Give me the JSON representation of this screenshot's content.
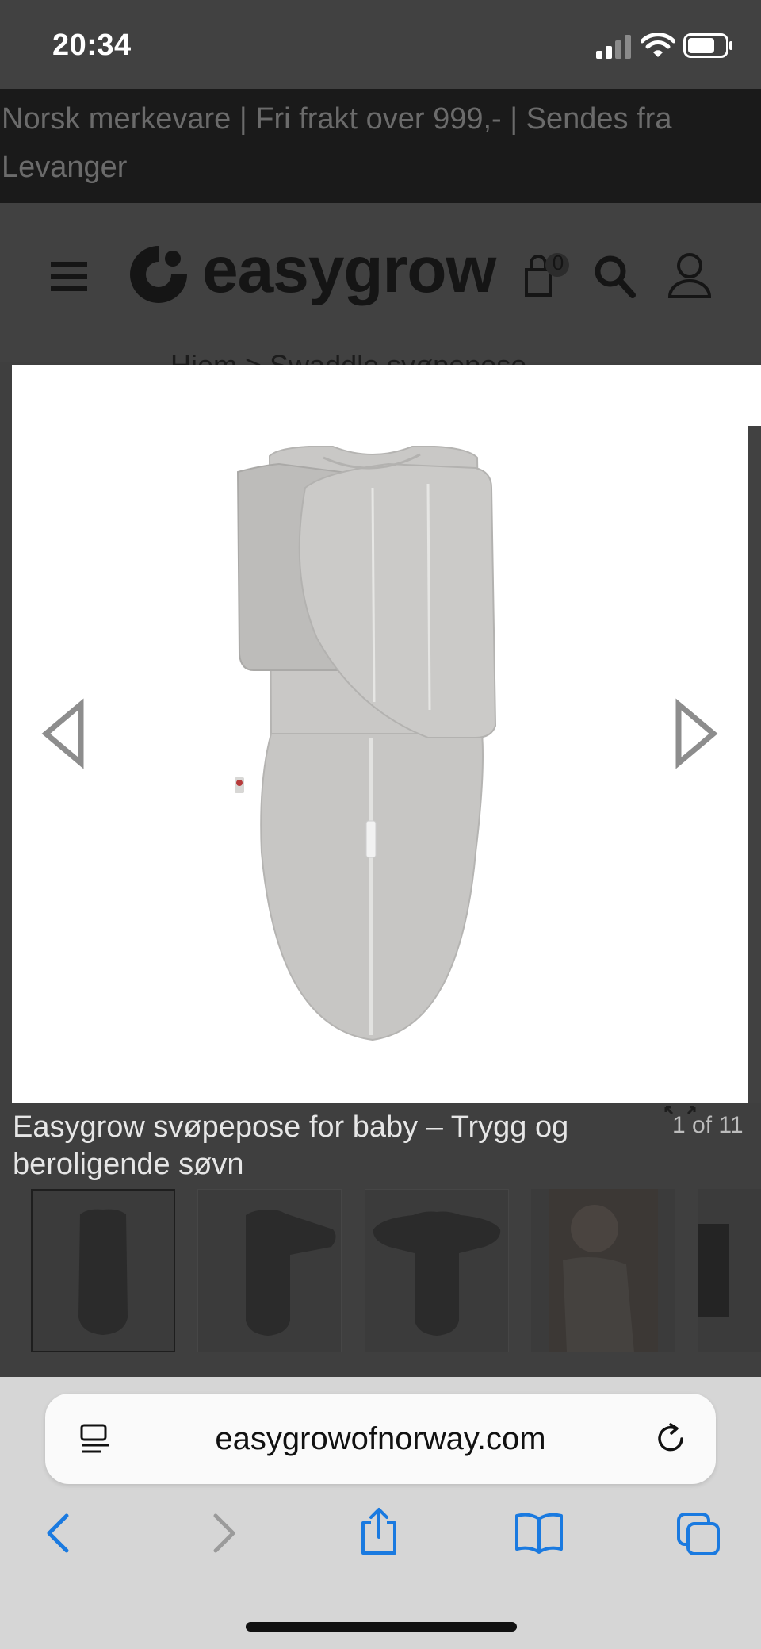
{
  "status_bar": {
    "time": "20:34"
  },
  "announcement": {
    "text": "Norsk merkevare | Fri frakt over 999,- | Sendes fra Levanger"
  },
  "header": {
    "logo_text": "easygrow",
    "cart_count": "0"
  },
  "breadcrumb": {
    "text": "Hjem  >  Swaddle svøpepose"
  },
  "lightbox": {
    "caption": "Easygrow svøpepose for baby – Trygg og beroligende søvn",
    "counter": "1 of 11"
  },
  "browser": {
    "url": "easygrowofnorway.com"
  },
  "colors": {
    "accent": "#1a7ae0",
    "overlay": "#3f3f3f"
  }
}
